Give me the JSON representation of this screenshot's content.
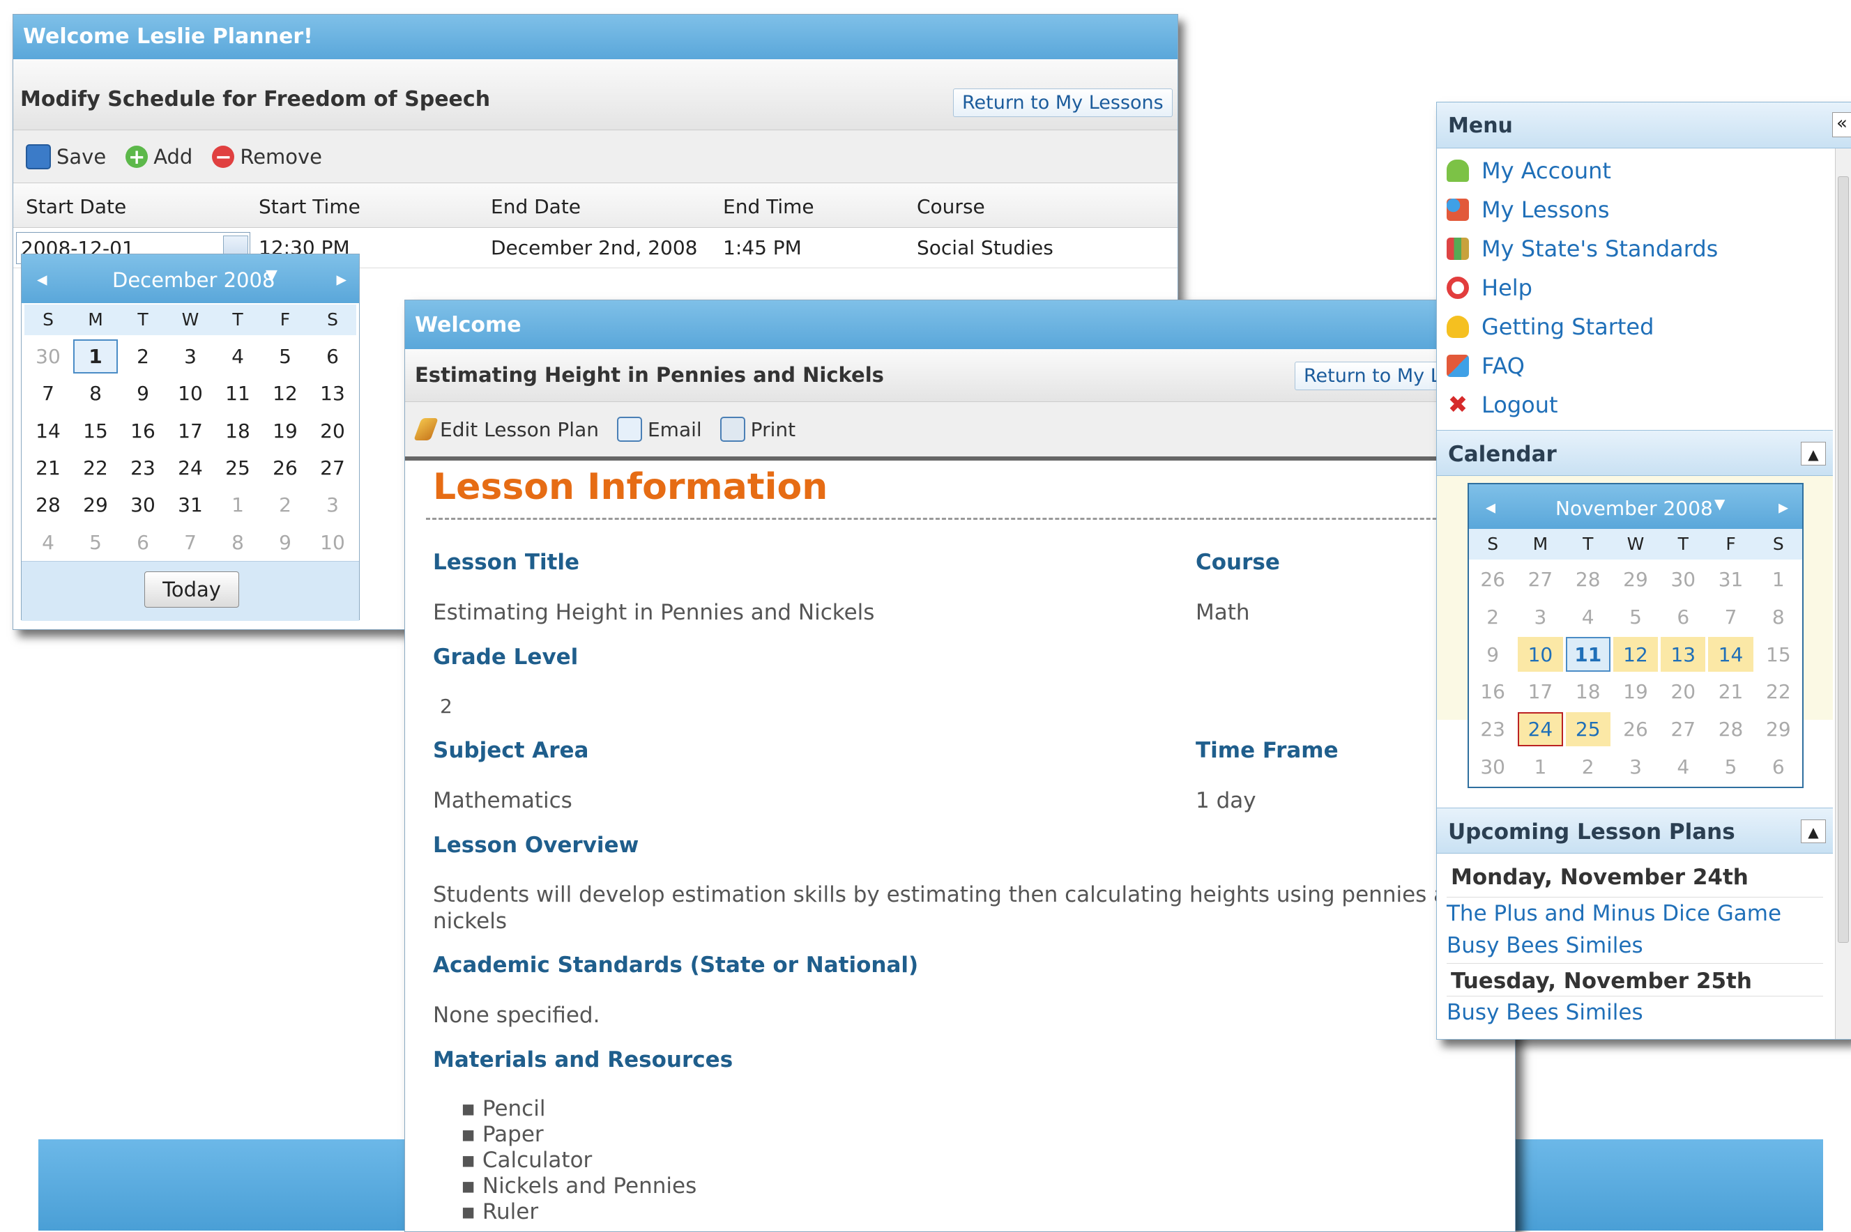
{
  "schedule_window": {
    "title": "Welcome Leslie Planner!",
    "subtitle": "Modify Schedule for Freedom of Speech",
    "return_button": "Return to My Lessons",
    "toolbar": {
      "save": "Save",
      "add": "Add",
      "remove": "Remove"
    },
    "columns": [
      "Start Date",
      "Start Time",
      "End Date",
      "End Time",
      "Course"
    ],
    "row": {
      "start_date": "2008-12-01",
      "start_time": "12:30 PM",
      "end_date": "December 2nd, 2008",
      "end_time": "1:45 PM",
      "course": "Social Studies"
    },
    "datepicker": {
      "month": "December 2008",
      "days": [
        "S",
        "M",
        "T",
        "W",
        "T",
        "F",
        "S"
      ],
      "weeks": [
        [
          "30",
          "1",
          "2",
          "3",
          "4",
          "5",
          "6"
        ],
        [
          "7",
          "8",
          "9",
          "10",
          "11",
          "12",
          "13"
        ],
        [
          "14",
          "15",
          "16",
          "17",
          "18",
          "19",
          "20"
        ],
        [
          "21",
          "22",
          "23",
          "24",
          "25",
          "26",
          "27"
        ],
        [
          "28",
          "29",
          "30",
          "31",
          "1",
          "2",
          "3"
        ],
        [
          "4",
          "5",
          "6",
          "7",
          "8",
          "9",
          "10"
        ]
      ],
      "today_button": "Today"
    }
  },
  "lesson_window": {
    "title": "Welcome",
    "subtitle": "Estimating Height in Pennies and Nickels",
    "return_button": "Return to My L",
    "toolbar": {
      "edit": "Edit Lesson Plan",
      "email": "Email",
      "print": "Print"
    },
    "heading": "Lesson Information",
    "lesson_title_label": "Lesson Title",
    "lesson_title": "Estimating Height in Pennies and Nickels",
    "course_label": "Course",
    "course": "Math",
    "grade_label": "Grade Level",
    "grade": "2",
    "subject_label": "Subject Area",
    "subject": "Mathematics",
    "timeframe_label": "Time Frame",
    "timeframe": "1 day",
    "overview_label": "Lesson Overview",
    "overview": "Students will develop estimation skills by estimating then calculating heights using pennies and nickels",
    "standards_label": "Academic Standards (State or National)",
    "standards": "None specified.",
    "materials_label": "Materials and Resources",
    "materials": [
      "Pencil",
      "Paper",
      "Calculator",
      "Nickels and Pennies",
      "Ruler"
    ]
  },
  "side_panel": {
    "menu_title": "Menu",
    "menu_items": [
      {
        "label": "My Account",
        "icon": "person-icon",
        "color": "#7cc246"
      },
      {
        "label": "My Lessons",
        "icon": "shapes-icon",
        "color": "#e2593a"
      },
      {
        "label": "My State's Standards",
        "icon": "books-icon",
        "color": "#c8a23c"
      },
      {
        "label": "Help",
        "icon": "lifebuoy-icon",
        "color": "#e23d3d"
      },
      {
        "label": "Getting Started",
        "icon": "lightbulb-icon",
        "color": "#f5c020"
      },
      {
        "label": "FAQ",
        "icon": "faq-icon",
        "color": "#e2593a"
      },
      {
        "label": "Logout",
        "icon": "x-icon",
        "color": "#d62a2a"
      }
    ],
    "calendar_title": "Calendar",
    "calendar": {
      "month": "November 2008",
      "days": [
        "S",
        "M",
        "T",
        "W",
        "T",
        "F",
        "S"
      ],
      "weeks": [
        [
          "26",
          "27",
          "28",
          "29",
          "30",
          "31",
          "1"
        ],
        [
          "2",
          "3",
          "4",
          "5",
          "6",
          "7",
          "8"
        ],
        [
          "9",
          "10",
          "11",
          "12",
          "13",
          "14",
          "15"
        ],
        [
          "16",
          "17",
          "18",
          "19",
          "20",
          "21",
          "22"
        ],
        [
          "23",
          "24",
          "25",
          "26",
          "27",
          "28",
          "29"
        ],
        [
          "30",
          "1",
          "2",
          "3",
          "4",
          "5",
          "6"
        ]
      ]
    },
    "upcoming_title": "Upcoming Lesson Plans",
    "upcoming": [
      {
        "day": "Monday, November 24th",
        "lessons": [
          "The Plus and Minus Dice Game",
          "Busy Bees Similes"
        ]
      },
      {
        "day": "Tuesday, November 25th",
        "lessons": [
          "Busy Bees Similes"
        ]
      }
    ]
  }
}
